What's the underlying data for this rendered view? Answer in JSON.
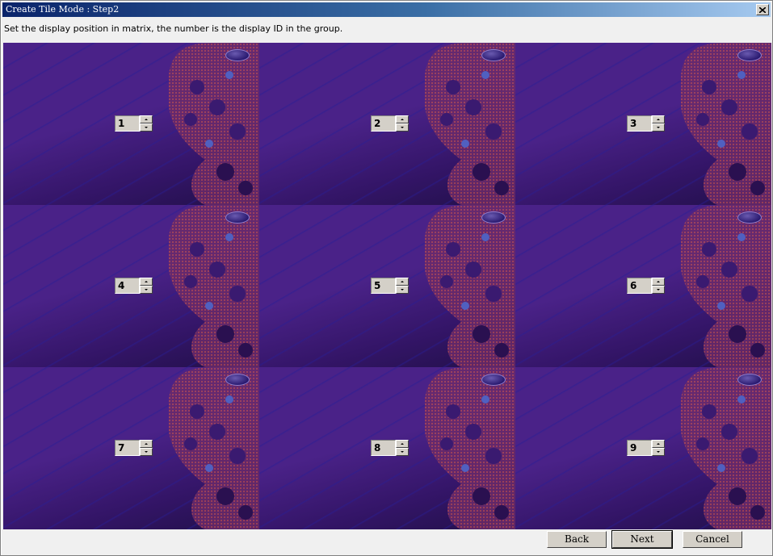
{
  "window": {
    "title": "Create Tile Mode : Step2"
  },
  "instruction": "Set the display position in matrix, the number is the display ID in the group.",
  "tiles": [
    {
      "id": "1"
    },
    {
      "id": "2"
    },
    {
      "id": "3"
    },
    {
      "id": "4"
    },
    {
      "id": "5"
    },
    {
      "id": "6"
    },
    {
      "id": "7"
    },
    {
      "id": "8"
    },
    {
      "id": "9"
    }
  ],
  "buttons": {
    "back": "Back",
    "next": "Next",
    "cancel": "Cancel"
  },
  "icons": {
    "close": "close-icon",
    "spin_up": "spin-up-icon",
    "spin_down": "spin-down-icon",
    "brand": "benq-logo"
  },
  "colors": {
    "title_start": "#0a246a",
    "title_end": "#a6caf0",
    "wallpaper": "#4a2288"
  }
}
